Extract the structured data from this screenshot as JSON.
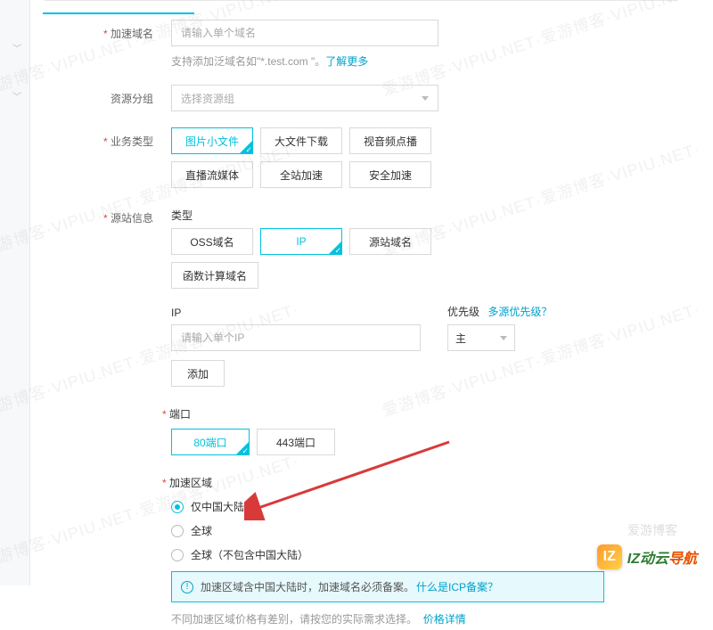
{
  "form": {
    "domain": {
      "label": "加速域名",
      "placeholder": "请输入单个域名",
      "hint_prefix": "支持添加泛域名如\"*.test.com \"。",
      "hint_link": "了解更多"
    },
    "resource_group": {
      "label": "资源分组",
      "placeholder": "选择资源组"
    },
    "biz_type": {
      "label": "业务类型",
      "options": [
        "图片小文件",
        "大文件下载",
        "视音频点播",
        "直播流媒体",
        "全站加速",
        "安全加速"
      ],
      "selected_index": 0
    },
    "origin": {
      "label": "源站信息",
      "type_label": "类型",
      "type_options": [
        "OSS域名",
        "IP",
        "源站域名",
        "函数计算域名"
      ],
      "type_selected_index": 1,
      "ip_label": "IP",
      "ip_placeholder": "请输入单个IP",
      "priority_label": "优先级",
      "priority_link": "多源优先级？",
      "priority_value": "主",
      "add_btn": "添加"
    },
    "port": {
      "label": "端口",
      "options": [
        "80端口",
        "443端口"
      ],
      "selected_index": 0
    },
    "region": {
      "label": "加速区域",
      "options": [
        "仅中国大陆",
        "全球",
        "全球（不包含中国大陆）"
      ],
      "selected_index": 0,
      "notice_text": "加速区域含中国大陆时，加速域名必须备案。",
      "notice_link": "什么是ICP备案？",
      "foot_hint_text": "不同加速区域价格有差别，请按您的实际需求选择。",
      "foot_hint_link": "价格详情"
    }
  },
  "watermark": "爱游博客·VIPIU.NET·爱游博客·VIPIU.NET·",
  "brand": {
    "mark": "IZ",
    "text1": "IZ动云",
    "text2": "导航"
  },
  "wm_small": "爱游博客"
}
